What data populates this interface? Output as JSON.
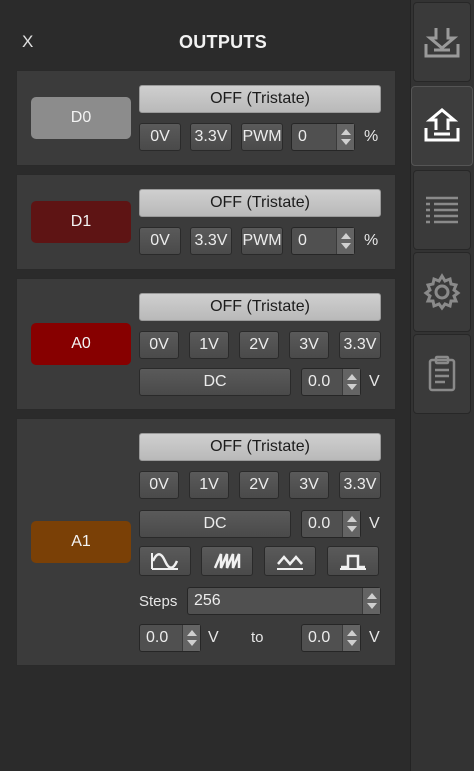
{
  "header": {
    "close_label": "X",
    "title": "OUTPUTS"
  },
  "colors": {
    "d0": "#8c8c8c",
    "d1": "#5e1414",
    "a0": "#870000",
    "a1": "#7a4006"
  },
  "d0": {
    "pin_label": "D0",
    "off_label": "OFF (Tristate)",
    "btn_0v": "0V",
    "btn_33v": "3.3V",
    "btn_pwm": "PWM",
    "pwm_value": "0",
    "unit": "%"
  },
  "d1": {
    "pin_label": "D1",
    "off_label": "OFF (Tristate)",
    "btn_0v": "0V",
    "btn_33v": "3.3V",
    "btn_pwm": "PWM",
    "pwm_value": "0",
    "unit": "%"
  },
  "a0": {
    "pin_label": "A0",
    "off_label": "OFF (Tristate)",
    "btn_0v": "0V",
    "btn_1v": "1V",
    "btn_2v": "2V",
    "btn_3v": "3V",
    "btn_33v": "3.3V",
    "dc_label": "DC",
    "dc_value": "0.0",
    "unit": "V"
  },
  "a1": {
    "pin_label": "A1",
    "off_label": "OFF (Tristate)",
    "btn_0v": "0V",
    "btn_1v": "1V",
    "btn_2v": "2V",
    "btn_3v": "3V",
    "btn_33v": "3.3V",
    "dc_label": "DC",
    "dc_value": "0.0",
    "unit": "V",
    "waveforms": [
      "sine-wave-icon",
      "sawtooth-wave-icon",
      "triangle-wave-icon",
      "square-wave-icon"
    ],
    "steps_label": "Steps",
    "steps_value": "256",
    "from_value": "0.0",
    "from_unit": "V",
    "to_label": "to",
    "to_value": "0.0",
    "to_unit": "V"
  },
  "sidebar": {
    "tabs": [
      "inputs-tray-icon",
      "outputs-tray-icon",
      "list-icon",
      "gear-icon",
      "clipboard-icon"
    ],
    "active": "outputs-tray-icon"
  }
}
